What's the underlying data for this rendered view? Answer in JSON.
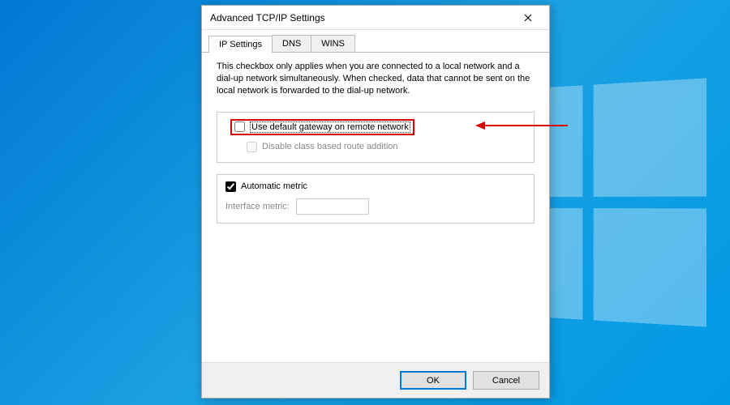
{
  "dialog": {
    "title": "Advanced TCP/IP Settings",
    "tabs": [
      "IP Settings",
      "DNS",
      "WINS"
    ],
    "active_tab": 0,
    "description": "This checkbox only applies when you are connected to a local network and a dial-up network simultaneously.  When checked, data that cannot be sent on the local network is forwarded to the dial-up network.",
    "opt_gateway": {
      "label": "Use default gateway on remote network",
      "checked": false
    },
    "opt_route": {
      "label": "Disable class based route addition",
      "checked": false
    },
    "opt_autometric": {
      "label": "Automatic metric",
      "checked": true
    },
    "metric_label": "Interface metric:",
    "metric_value": "",
    "ok": "OK",
    "cancel": "Cancel"
  }
}
